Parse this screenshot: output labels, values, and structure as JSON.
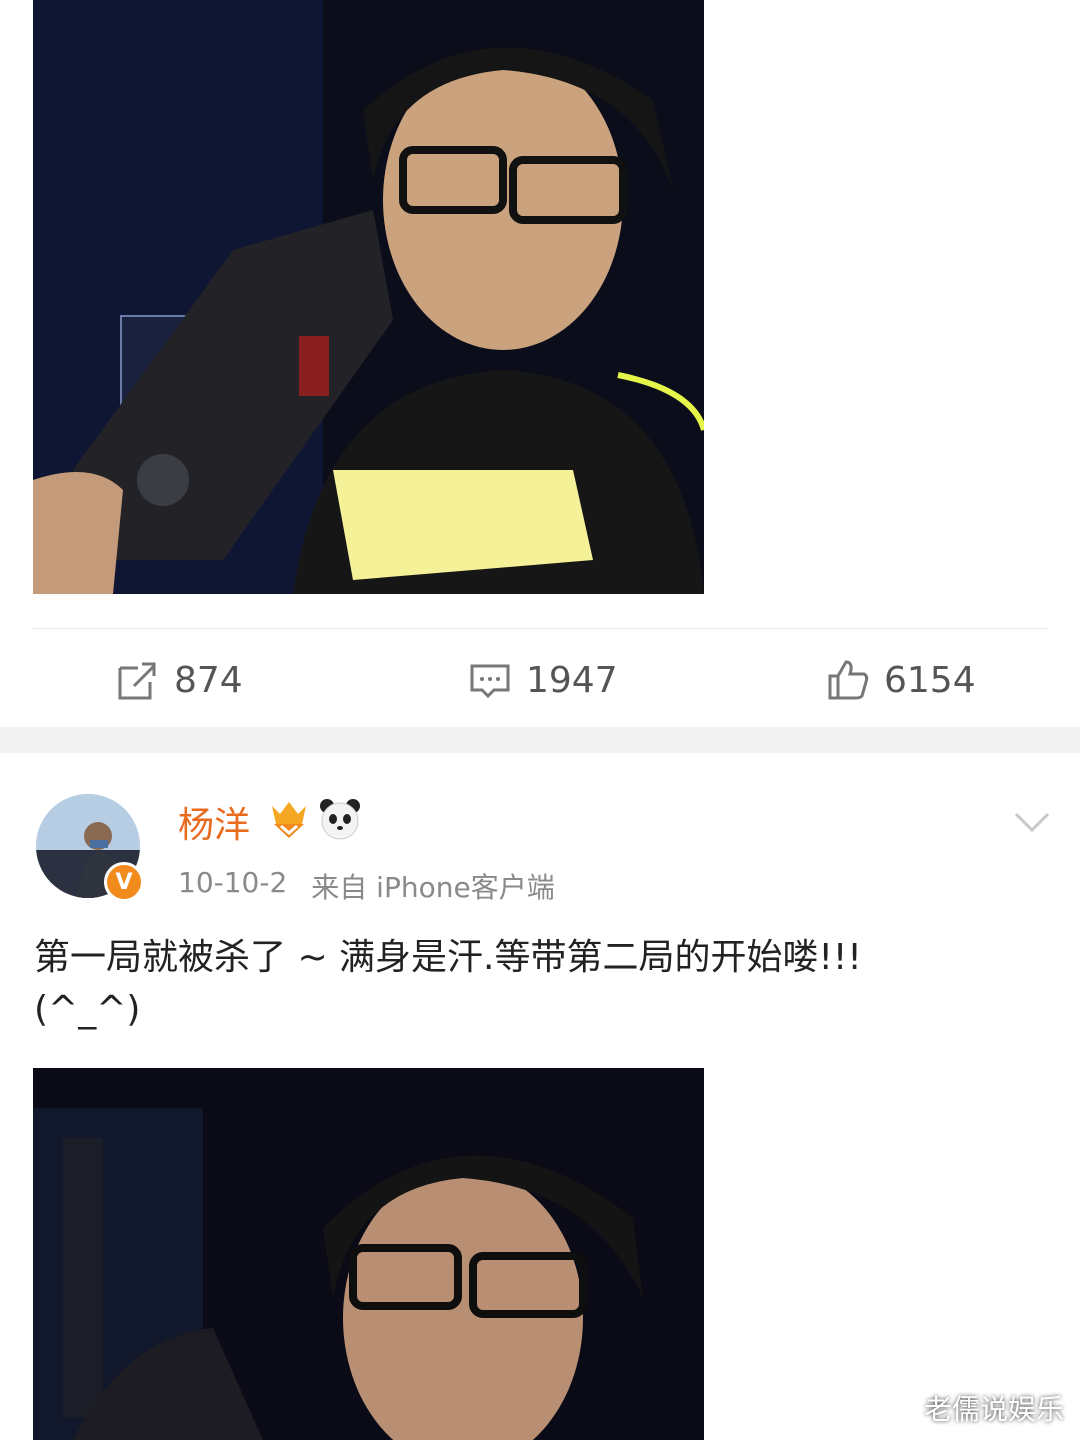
{
  "post1": {
    "actions": {
      "repost_count": "874",
      "comment_count": "1947",
      "like_count": "6154"
    }
  },
  "post2": {
    "author": "杨洋",
    "verified_badge": "V",
    "date": "10-10-2",
    "source": "来自 iPhone客户端",
    "text_line1": "第一局就被杀了 ~ 满身是汗.等带第二局的开始喽!!!",
    "text_line2": "(^_^)"
  },
  "watermark": "老儒说娱乐",
  "icons": {
    "repost": "repost-icon",
    "comment": "comment-icon",
    "like": "thumbs-up-icon",
    "vip": "vip-level-icon",
    "emoji": "panda-icon",
    "menu": "chevron-down-icon"
  },
  "colors": {
    "username": "#e86b1f",
    "verify_badge": "#f28b1d",
    "meta_text": "#8a8a8a",
    "action_text": "#555555",
    "separator": "#f2f2f2"
  }
}
